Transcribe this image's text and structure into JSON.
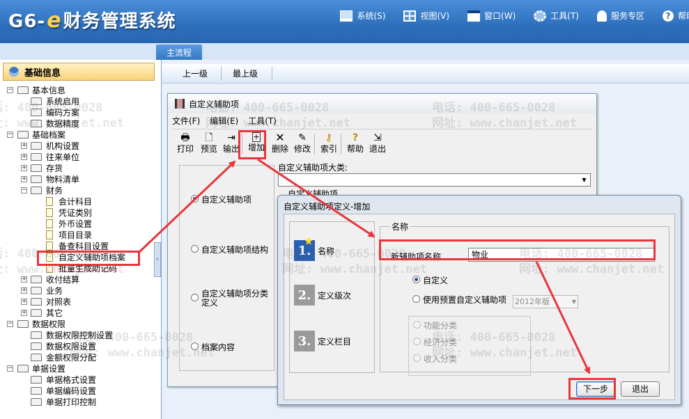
{
  "app": {
    "logo_prefix": "G6-",
    "logo_e": "e",
    "logo_title": "财务管理系统",
    "menu": [
      {
        "icon": "monitor-icon",
        "label": "系统(S)"
      },
      {
        "icon": "grid-view-icon",
        "label": "视图(V)"
      },
      {
        "icon": "window-icon",
        "label": "窗口(W)"
      },
      {
        "icon": "gear-icon",
        "label": "工具(T)"
      },
      {
        "icon": "service-person-icon",
        "label": "服务专区"
      },
      {
        "icon": "help-icon",
        "label": "帮助"
      }
    ]
  },
  "tabs": {
    "main": "主流程"
  },
  "nav": {
    "up": "上一级",
    "top": "最上级"
  },
  "sidebar": {
    "header": "基础信息",
    "tree": [
      {
        "label": "基本信息"
      },
      {
        "label": "系统启用"
      },
      {
        "label": "编码方案"
      },
      {
        "label": "数据精度"
      },
      {
        "label": "基础档案"
      },
      {
        "label": "机构设置"
      },
      {
        "label": "往来单位"
      },
      {
        "label": "存货"
      },
      {
        "label": "物料清单"
      },
      {
        "label": "财务"
      },
      {
        "label": "会计科目"
      },
      {
        "label": "凭证类别"
      },
      {
        "label": "外币设置"
      },
      {
        "label": "项目目录"
      },
      {
        "label": "备查科目设置"
      },
      {
        "label": "自定义辅助项档案"
      },
      {
        "label": "批量生成助记码"
      },
      {
        "label": "收付结算"
      },
      {
        "label": "业务"
      },
      {
        "label": "对照表"
      },
      {
        "label": "其它"
      },
      {
        "label": "数据权限"
      },
      {
        "label": "数据权限控制设置"
      },
      {
        "label": "数据权限设置"
      },
      {
        "label": "金额权限分配"
      },
      {
        "label": "单据设置"
      },
      {
        "label": "单据格式设置"
      },
      {
        "label": "单据编码设置"
      },
      {
        "label": "单据打印控制"
      }
    ]
  },
  "win1": {
    "title": "自定义辅助项",
    "menu": [
      "文件(F)",
      "编辑(E)",
      "工具(T)"
    ],
    "toolbar": [
      {
        "icon": "printer-icon",
        "label": "打印"
      },
      {
        "icon": "preview-icon",
        "label": "预览"
      },
      {
        "icon": "export-icon",
        "label": "输出"
      },
      {
        "icon": "add-icon",
        "label": "增加"
      },
      {
        "icon": "delete-icon",
        "label": "删除"
      },
      {
        "icon": "edit-icon",
        "label": "修改"
      },
      {
        "icon": "key-icon",
        "label": "索引"
      },
      {
        "icon": "help-icon",
        "label": "帮助"
      },
      {
        "icon": "exit-icon",
        "label": "退出"
      }
    ],
    "radios": [
      {
        "label": "自定义辅助项",
        "checked": true
      },
      {
        "label": "自定义辅助项结构",
        "checked": false
      },
      {
        "label": "自定义辅助项分类定义",
        "checked": false
      },
      {
        "label": "档案内容",
        "checked": false
      }
    ],
    "category_label": "自定义辅助项大类:",
    "item_label": "自定义辅助项"
  },
  "win2": {
    "title": "自定义辅助项定义-增加",
    "steps": [
      {
        "num": "1.",
        "label": "名称"
      },
      {
        "num": "2.",
        "label": "定义级次"
      },
      {
        "num": "3.",
        "label": "定义栏目"
      }
    ],
    "group_title": "名称",
    "name_label": "新辅助项名称",
    "name_value": "物业",
    "opt_custom": "自定义",
    "opt_preset": "使用预置自定义辅助项",
    "preset_value": "2012年版",
    "sub_options": [
      "功能分类",
      "经济分类",
      "收入分类"
    ],
    "btn_next": "下一步",
    "btn_exit": "退出"
  },
  "watermark": {
    "phone": "电话: 400-665-0028",
    "site": "网址: www.chanjet.net"
  },
  "colors": {
    "highlight": "#e8353a",
    "banner": "#2d6fbd"
  }
}
